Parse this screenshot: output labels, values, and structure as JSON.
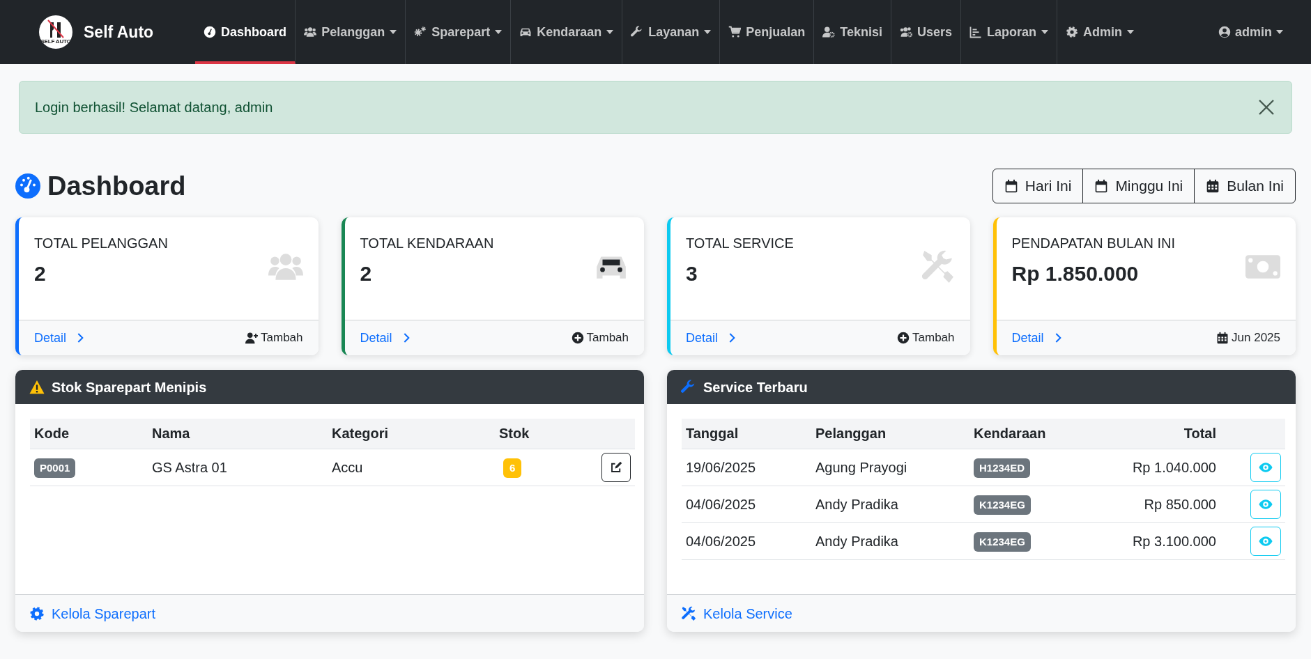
{
  "brand": {
    "name": "Self Auto",
    "logo_text": "SELF AUTO"
  },
  "nav": [
    {
      "label": "Dashboard",
      "selected": true,
      "dropdown": false
    },
    {
      "label": "Pelanggan",
      "selected": false,
      "dropdown": true
    },
    {
      "label": "Sparepart",
      "selected": false,
      "dropdown": true
    },
    {
      "label": "Kendaraan",
      "selected": false,
      "dropdown": true
    },
    {
      "label": "Layanan",
      "selected": false,
      "dropdown": true
    },
    {
      "label": "Penjualan",
      "selected": false,
      "dropdown": false
    },
    {
      "label": "Teknisi",
      "selected": false,
      "dropdown": false
    },
    {
      "label": "Users",
      "selected": false,
      "dropdown": false
    },
    {
      "label": "Laporan",
      "selected": false,
      "dropdown": true
    },
    {
      "label": "Admin",
      "selected": false,
      "dropdown": true
    }
  ],
  "user_menu": {
    "label": "admin",
    "dropdown": true
  },
  "alert": {
    "message": "Login berhasil! Selamat datang, admin"
  },
  "page_title": "Dashboard",
  "period_buttons": [
    {
      "label": "Hari Ini"
    },
    {
      "label": "Minggu Ini"
    },
    {
      "label": "Bulan Ini"
    }
  ],
  "cards": [
    {
      "title": "TOTAL PELANGGAN",
      "value": "2",
      "color": "#0d6efd",
      "link": "Detail",
      "action": "Tambah"
    },
    {
      "title": "TOTAL KENDARAAN",
      "value": "2",
      "color": "#198754",
      "link": "Detail",
      "action": "Tambah"
    },
    {
      "title": "TOTAL SERVICE",
      "value": "3",
      "color": "#0dcaf0",
      "link": "Detail",
      "action": "Tambah"
    },
    {
      "title": "PENDAPATAN BULAN INI",
      "value": "Rp 1.850.000",
      "color": "#ffc107",
      "link": "Detail",
      "action": "Jun 2025"
    }
  ],
  "stock_panel": {
    "title": "Stok Sparepart Menipis",
    "columns": [
      "Kode",
      "Nama",
      "Kategori",
      "Stok"
    ],
    "rows": [
      {
        "kode": "P0001",
        "nama": "GS Astra 01",
        "kategori": "Accu",
        "stok": "6"
      }
    ],
    "footer_link": "Kelola Sparepart"
  },
  "service_panel": {
    "title": "Service Terbaru",
    "columns": [
      "Tanggal",
      "Pelanggan",
      "Kendaraan",
      "Total"
    ],
    "rows": [
      {
        "tanggal": "19/06/2025",
        "pelanggan": "Agung Prayogi",
        "kendaraan": "H1234ED",
        "total": "Rp 1.040.000"
      },
      {
        "tanggal": "04/06/2025",
        "pelanggan": "Andy Pradika",
        "kendaraan": "K1234EG",
        "total": "Rp 850.000"
      },
      {
        "tanggal": "04/06/2025",
        "pelanggan": "Andy Pradika",
        "kendaraan": "K1234EG",
        "total": "Rp 3.100.000"
      }
    ],
    "footer_link": "Kelola Service"
  }
}
